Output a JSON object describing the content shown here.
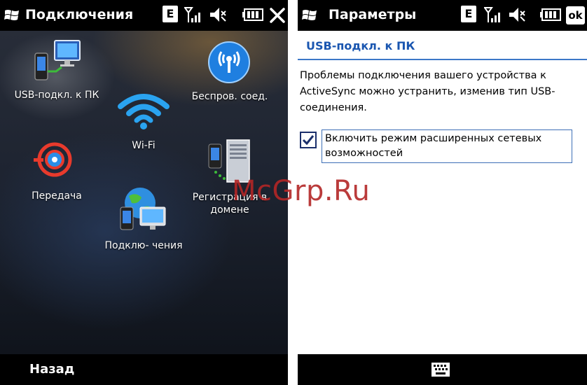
{
  "left_screen": {
    "title": "Подключения",
    "status": {
      "network_type": "E"
    },
    "apps": [
      {
        "label": "USB-подкл. к ПК",
        "icon": "usb-pc-connection-icon"
      },
      {
        "label": "Wi-Fi",
        "icon": "wifi-icon"
      },
      {
        "label": "Беспров. соед.",
        "icon": "wireless-antenna-icon"
      },
      {
        "label": "Передача",
        "icon": "beam-transfer-icon"
      },
      {
        "label": "Регистрация в",
        "label2": "домене",
        "icon": "domain-server-icon"
      },
      {
        "label": "Подклю- чения",
        "icon": "network-connections-icon"
      }
    ],
    "softkey_left": "Назад"
  },
  "right_screen": {
    "title": "Параметры",
    "status": {
      "network_type": "E",
      "ok_label": "ok"
    },
    "section_title": "USB-подкл. к ПК",
    "description": "Проблемы подключения вашего устройства к ActiveSync можно устранить, изменив тип USB-соединения.",
    "checkbox": {
      "label": "Включить режим расширенных сетевых возможностей",
      "checked": true
    }
  },
  "watermark": "McGrp.Ru",
  "colors": {
    "accent": "#1a56b0",
    "titlebar": "#000000",
    "watermark": "#b32626"
  }
}
